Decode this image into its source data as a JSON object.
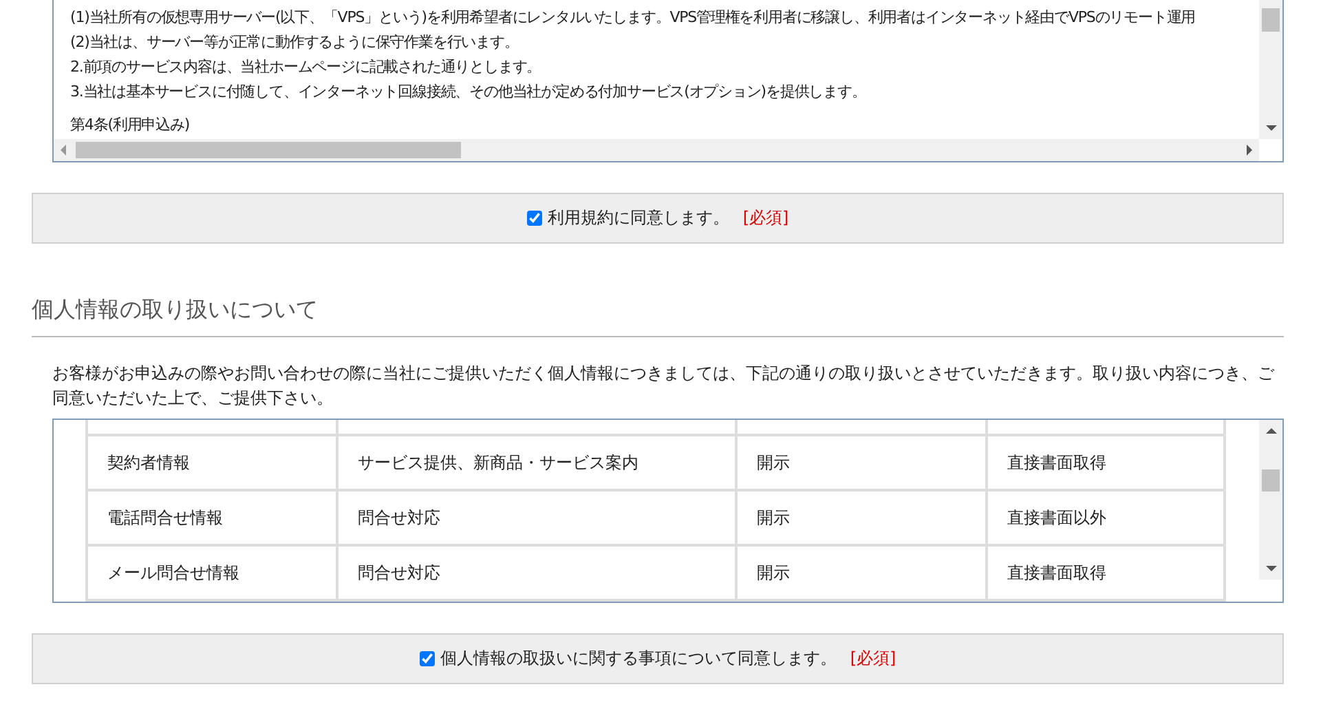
{
  "terms": {
    "lines": [
      "(1)当社所有の仮想専用サーバー(以下、「VPS」という)を利用希望者にレンタルいたします。VPS管理権を利用者に移譲し、利用者はインターネット経由でVPSのリモート運用",
      "(2)当社は、サーバー等が正常に動作するように保守作業を行います。",
      "2.前項のサービス内容は、当社ホームページに記載された通りとします。",
      "3.当社は基本サービスに付随して、インターネット回線接続、その他当社が定める付加サービス(オプション)を提供します。",
      "第4条(利用申込み)"
    ]
  },
  "terms_agree": {
    "checked": true,
    "label": "利用規約に同意します。",
    "required": "[必須]"
  },
  "privacy": {
    "heading": "個人情報の取り扱いについて",
    "intro": "お客様がお申込みの際やお問い合わせの際に当社にご提供いただく個人情報につきましては、下記の通りの取り扱いとさせていただきます。取り扱い内容につき、ご同意いただいた上で、ご提供下さい。",
    "rows": [
      [
        "契約者情報",
        "サービス提供、新商品・サービス案内",
        "開示",
        "直接書面取得"
      ],
      [
        "電話問合せ情報",
        "問合せ対応",
        "開示",
        "直接書面以外"
      ],
      [
        "メール問合せ情報",
        "問合せ対応",
        "開示",
        "直接書面取得"
      ]
    ]
  },
  "privacy_agree": {
    "checked": true,
    "label": "個人情報の取扱いに関する事項について同意します。",
    "required": "[必須]"
  }
}
